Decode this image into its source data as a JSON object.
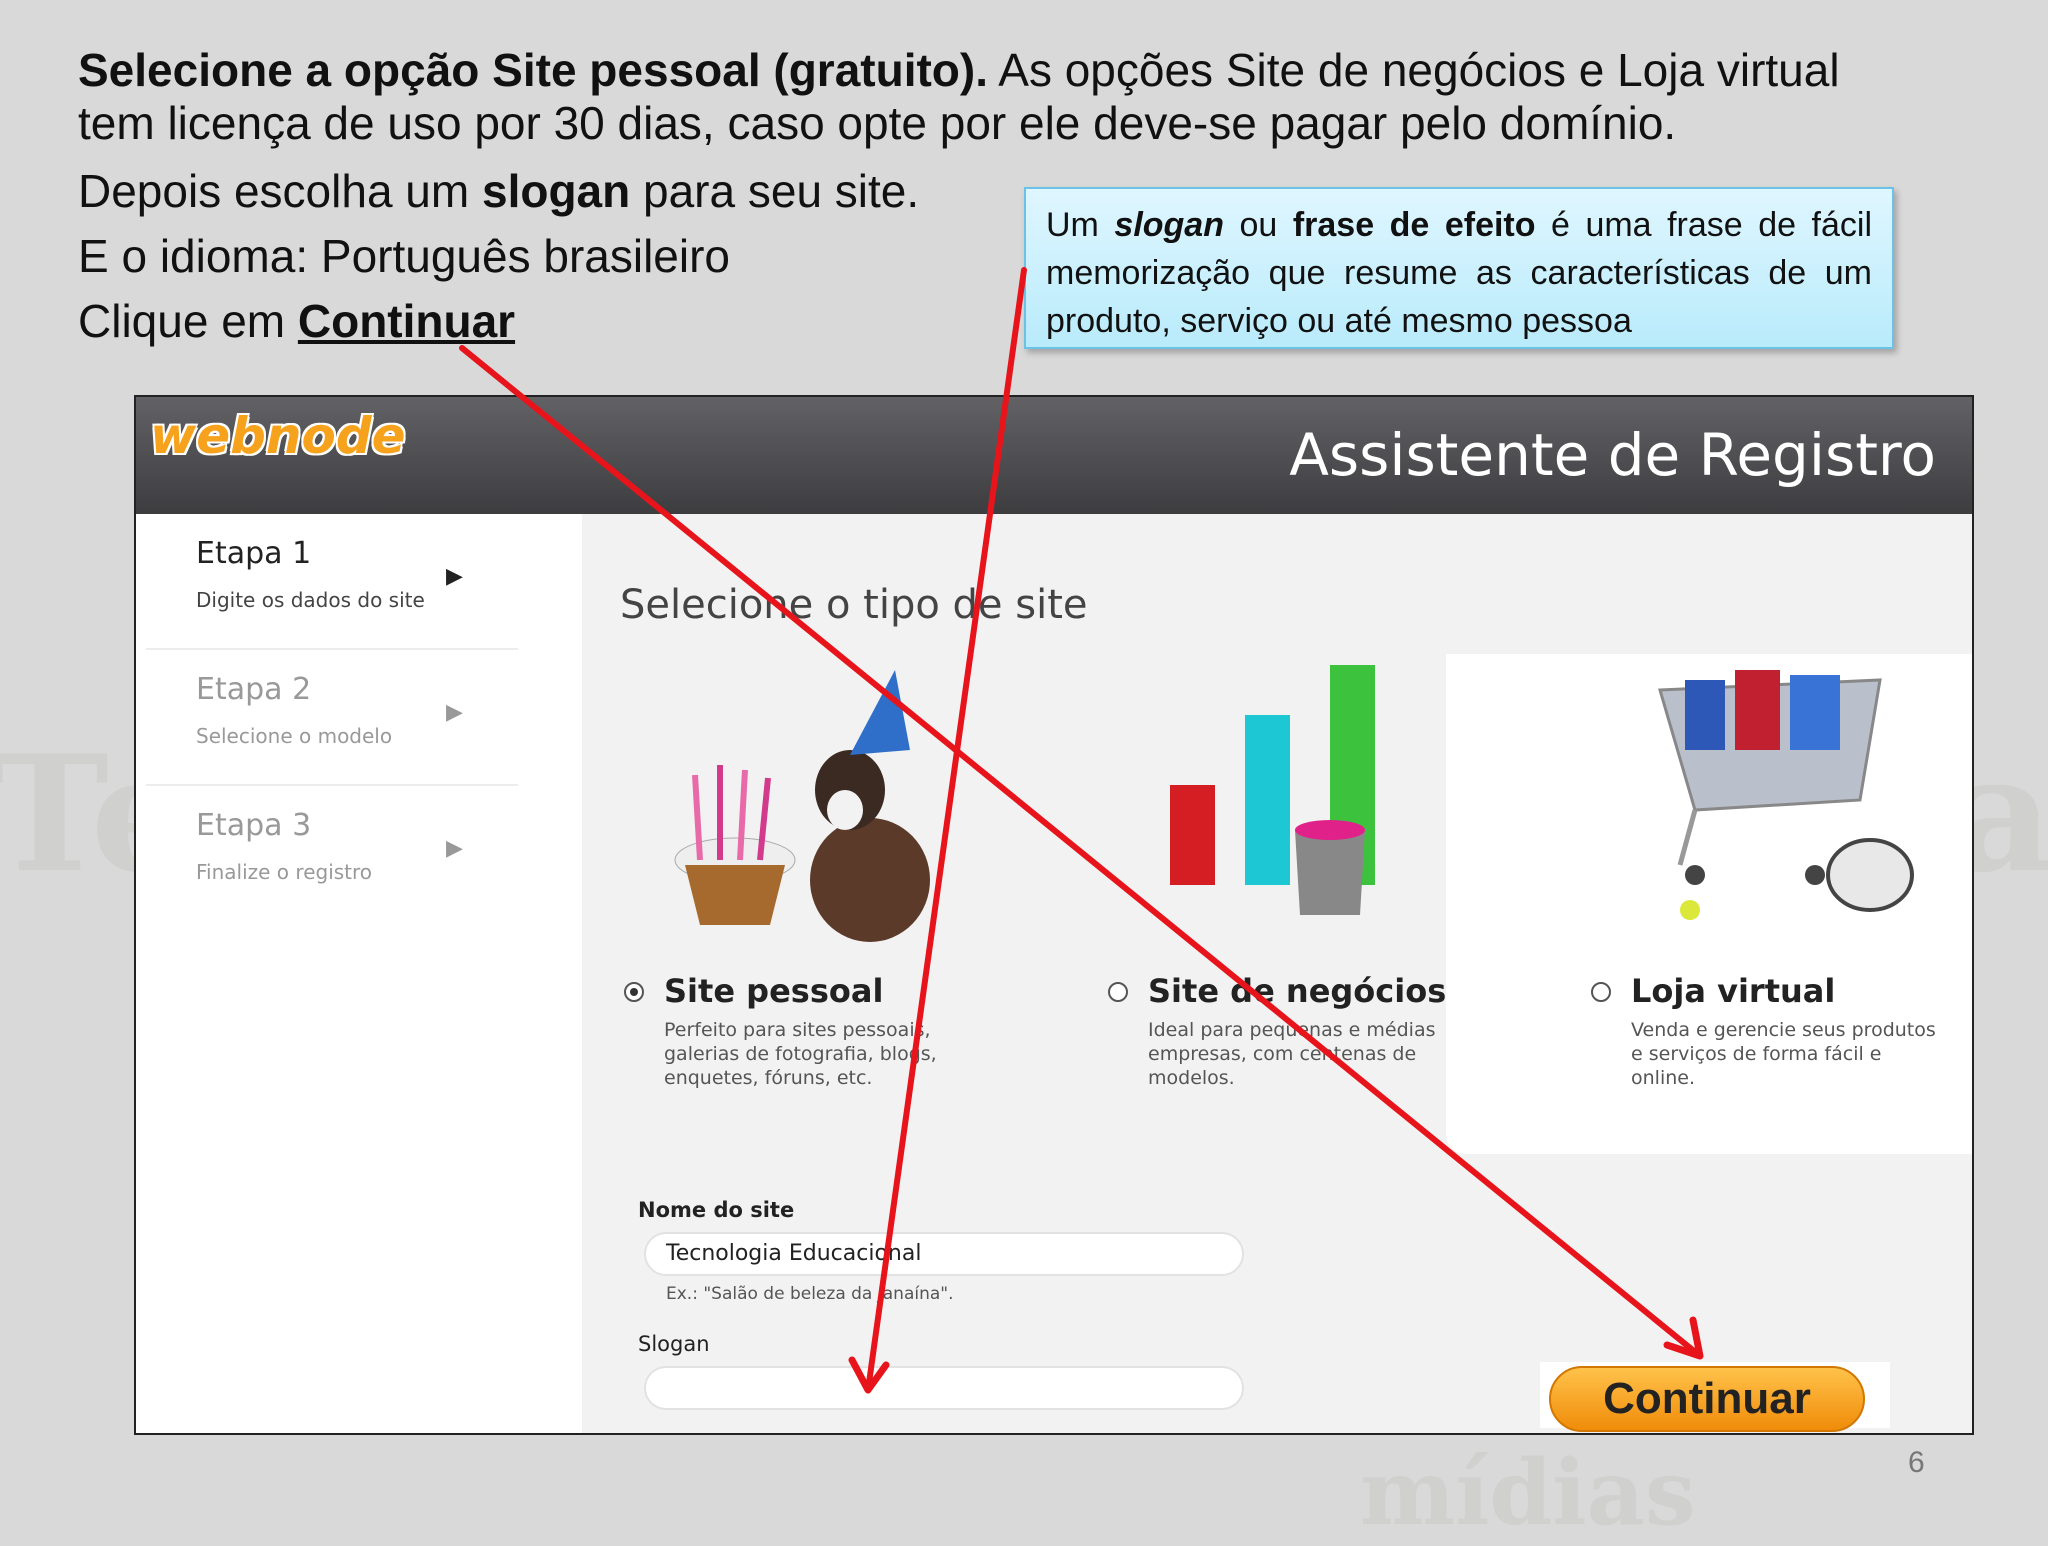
{
  "slide": {
    "intro_bold": "Selecione a opção Site pessoal (gratuito).",
    "intro_rest": " As opções Site de negócios e Loja virtual",
    "intro_line2": "tem licença de uso por 30 dias, caso opte por ele deve-se pagar pelo domínio.",
    "line3_pre": "Depois escolha um ",
    "line3_bold": "slogan",
    "line3_post": " para seu site.",
    "line4": "E o idioma: Português brasileiro",
    "line5_pre": "Clique em ",
    "line5_link": "Continuar",
    "page_number": "6"
  },
  "callout": {
    "t1": "Um ",
    "t2": "slogan",
    "t3": " ou ",
    "t4": "frase de efeito",
    "t5": " é uma frase de fácil memorização que resume as características de um produto, serviço ou até mesmo pessoa"
  },
  "app": {
    "logo": "webnode",
    "title": "Assistente de Registro",
    "steps": [
      {
        "title": "Etapa 1",
        "subtitle": "Digite os dados do site",
        "arrow": "▶"
      },
      {
        "title": "Etapa 2",
        "subtitle": "Selecione o modelo",
        "arrow": "▶"
      },
      {
        "title": "Etapa 3",
        "subtitle": "Finalize o registro",
        "arrow": "▶"
      }
    ],
    "select_title": "Selecione o tipo de site",
    "options": [
      {
        "title": "Site pessoal",
        "desc": "Perfeito para sites pessoais, galerias de fotografia, blogs, enquetes, fóruns, etc.",
        "selected": true
      },
      {
        "title": "Site de negócios",
        "desc": "Ideal para pequenas e médias empresas, com centenas de modelos.",
        "selected": false
      },
      {
        "title": "Loja virtual",
        "desc": "Venda e gerencie seus produtos e serviços de forma fácil e online.",
        "selected": false
      }
    ],
    "site_name_label": "Nome do site",
    "site_name_value": "Tecnologia Educacional",
    "site_name_hint": "Ex.: \"Salão de beleza da Janaína\".",
    "slogan_label": "Slogan",
    "slogan_value": "",
    "continue_button": "Continuar"
  },
  "colors": {
    "arrow": "#e8141b",
    "button": "#f59d18",
    "callout_bg": "#c7f0fd",
    "topbar": "#4a4a4d"
  }
}
